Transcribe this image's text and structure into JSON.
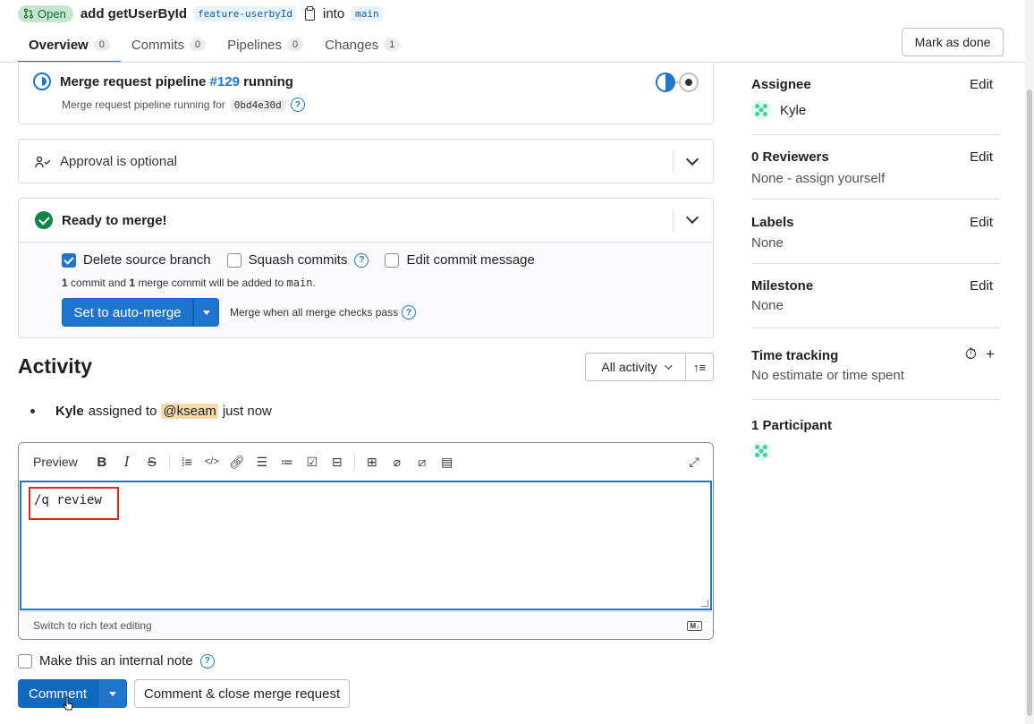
{
  "header": {
    "status": "Open",
    "title": "add getUserById",
    "source_branch": "feature-userbyId",
    "into": "into",
    "target_branch": "main"
  },
  "tabs": [
    {
      "label": "Overview",
      "count": "0"
    },
    {
      "label": "Commits",
      "count": "0"
    },
    {
      "label": "Pipelines",
      "count": "0"
    },
    {
      "label": "Changes",
      "count": "1"
    }
  ],
  "mark_done": "Mark as done",
  "pipeline": {
    "prefix": "Merge request pipeline",
    "link": "#129",
    "status": "running",
    "subtext": "Merge request pipeline running for",
    "sha": "0bd4e30d"
  },
  "approval": {
    "text": "Approval is optional"
  },
  "ready": {
    "title": "Ready to merge!",
    "options": [
      "Delete source branch",
      "Squash commits",
      "Edit commit message"
    ],
    "commit_info": {
      "n1": "1",
      "t1": "commit and",
      "n2": "1",
      "t2": "merge commit will be added to",
      "branch": "main",
      "end": "."
    },
    "auto_merge": "Set to auto-merge",
    "hint": "Merge when all merge checks pass"
  },
  "activity": {
    "title": "Activity",
    "filter": "All activity",
    "event": {
      "user": "Kyle",
      "action": "assigned to",
      "mention": "@kseam",
      "time": "just now"
    }
  },
  "editor": {
    "preview": "Preview",
    "content": "/q review",
    "switch_rich": "Switch to rich text editing",
    "md": "M↓"
  },
  "internal_note": "Make this an internal note",
  "comment_button": "Comment",
  "close_button": "Comment & close merge request",
  "sidebar": {
    "assignee": {
      "title": "Assignee",
      "edit": "Edit",
      "value": "Kyle"
    },
    "reviewers": {
      "title": "0 Reviewers",
      "edit": "Edit",
      "value": "None - assign yourself"
    },
    "labels": {
      "title": "Labels",
      "edit": "Edit",
      "value": "None"
    },
    "milestone": {
      "title": "Milestone",
      "edit": "Edit",
      "value": "None"
    },
    "time_tracking": {
      "title": "Time tracking",
      "value": "No estimate or time spent"
    },
    "participants": {
      "title": "1 Participant"
    }
  },
  "colors": {
    "accent": "#1f75cb",
    "success": "#108548",
    "highlight": "#dd2b0e"
  }
}
